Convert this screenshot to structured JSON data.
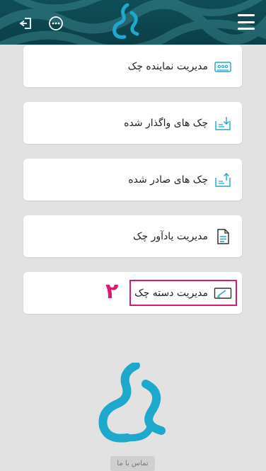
{
  "header": {
    "menu_icon": "hamburger-menu-icon",
    "more_icon": "more-options-icon",
    "exit_icon": "logout-icon",
    "logo_icon": "app-logo",
    "background_color": "#0d4750"
  },
  "menu_items": [
    {
      "label": "مدیریت نماینده چک",
      "icon": "cheque-representative-icon"
    },
    {
      "label": "چک های واگذار شده",
      "icon": "assigned-cheques-icon"
    },
    {
      "label": "چک های صادر شده",
      "icon": "issued-cheques-icon"
    },
    {
      "label": "مدیریت یادآور چک",
      "icon": "cheque-reminder-icon"
    },
    {
      "label": "مدیریت دسته چک",
      "icon": "chequebook-icon"
    }
  ],
  "annotation": {
    "step_number": "۲",
    "color": "#d81b72"
  },
  "footer": {
    "contact_label": "تماس با ما",
    "logo_icon": "app-logo"
  },
  "colors": {
    "accent": "#1ea8cc",
    "highlight": "#d81b72",
    "background": "#e2e2e2"
  }
}
